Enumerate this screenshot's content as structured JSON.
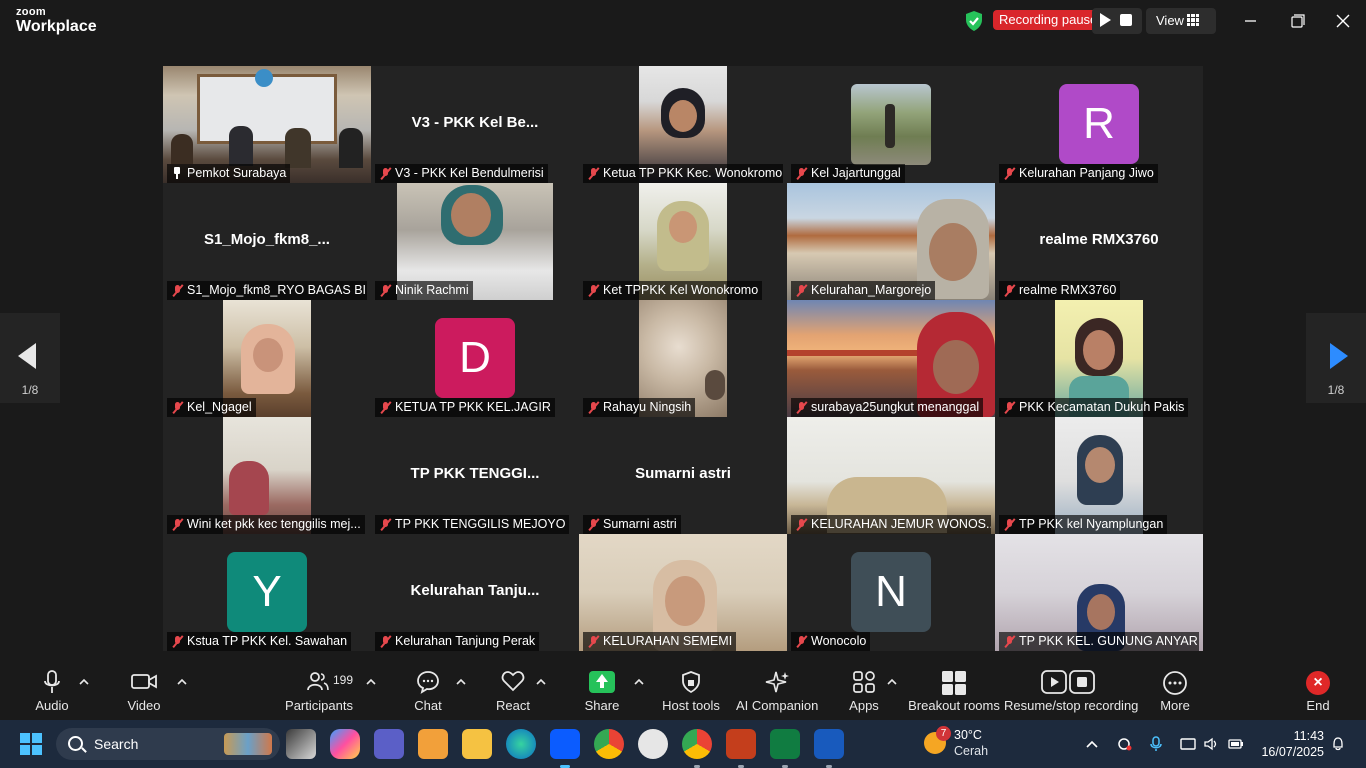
{
  "app": {
    "logo_top": "zoom",
    "logo_bottom": "Workplace"
  },
  "recording": {
    "status": "Recording paused"
  },
  "view": {
    "label": "View"
  },
  "gallery": {
    "page_left": "1/8",
    "page_right": "1/8",
    "tiles": [
      {
        "name": "Pemkot Surabaya",
        "type": "video",
        "pinned": true,
        "active": true
      },
      {
        "name": "V3 - PKK Kel Bendulmerisi",
        "type": "text",
        "display": "V3 - PKK Kel Be..."
      },
      {
        "name": "Ketua TP PKK Kec. Wonokromo",
        "type": "video"
      },
      {
        "name": "Kel Jajartunggal",
        "type": "video"
      },
      {
        "name": "Kelurahan Panjang Jiwo",
        "type": "avatar",
        "letter": "R",
        "color": "#b04ac8"
      },
      {
        "name": "S1_Mojo_fkm8_RYO BAGAS BI...",
        "type": "text",
        "display": "S1_Mojo_fkm8_..."
      },
      {
        "name": "Ninik Rachmi",
        "type": "video"
      },
      {
        "name": "Ket TPPKK Kel Wonokromo",
        "type": "video"
      },
      {
        "name": "Kelurahan_Margorejo",
        "type": "video"
      },
      {
        "name": "realme RMX3760",
        "type": "text",
        "display": "realme RMX3760"
      },
      {
        "name": "Kel_Ngagel",
        "type": "video"
      },
      {
        "name": "KETUA TP PKK KEL.JAGIR",
        "type": "avatar",
        "letter": "D",
        "color": "#cc1b5e"
      },
      {
        "name": "Rahayu Ningsih",
        "type": "video"
      },
      {
        "name": "surabaya25ungkut menanggal",
        "type": "video"
      },
      {
        "name": "PKK Kecamatan Dukuh Pakis",
        "type": "video"
      },
      {
        "name": "Wini ket pkk kec tenggilis mej...",
        "type": "video"
      },
      {
        "name": "TP PKK TENGGILIS MEJOYO",
        "type": "text",
        "display": "TP PKK TENGGI..."
      },
      {
        "name": "Sumarni astri",
        "type": "text",
        "display": "Sumarni astri"
      },
      {
        "name": "KELURAHAN JEMUR WONOS...",
        "type": "video"
      },
      {
        "name": "TP PKK kel Nyamplungan",
        "type": "video"
      },
      {
        "name": "Kstua TP PKK Kel. Sawahan",
        "type": "avatar",
        "letter": "Y",
        "color": "#0f8a7a"
      },
      {
        "name": "Kelurahan Tanjung Perak",
        "type": "text",
        "display": "Kelurahan  Tanju..."
      },
      {
        "name": "KELURAHAN SEMEMI",
        "type": "video"
      },
      {
        "name": "Wonocolo",
        "type": "avatar",
        "letter": "N",
        "color": "#3f4e57"
      },
      {
        "name": "TP PKK KEL. GUNUNG ANYAR",
        "type": "video"
      }
    ]
  },
  "toolbar": {
    "audio": "Audio",
    "video": "Video",
    "participants": "Participants",
    "participants_count": "199",
    "chat": "Chat",
    "react": "React",
    "share": "Share",
    "host_tools": "Host tools",
    "ai_companion": "AI Companion",
    "apps": "Apps",
    "breakout_rooms": "Breakout rooms",
    "resume_stop_recording": "Resume/stop recording",
    "more": "More",
    "end": "End"
  },
  "taskbar": {
    "search": "Search",
    "weather_temp": "30°C",
    "weather_desc": "Cerah",
    "weather_badge": "7",
    "time": "11:43",
    "date": "16/07/2025"
  },
  "colors": {
    "accent_green": "#2fd35b",
    "rec_red": "#d9262b",
    "nav_blue": "#2d8cff"
  }
}
